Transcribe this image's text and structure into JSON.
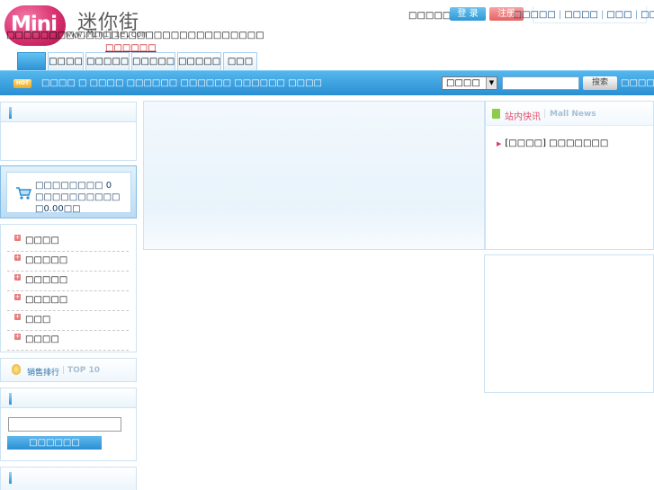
{
  "header": {
    "logo_text": "Mini",
    "logo_cn": "迷你街",
    "logo_url": "www.Minijie.com",
    "welcome": "□□□□□□",
    "login_label": "登 录",
    "register_label": "注册",
    "top_links": [
      "□□□□□",
      "□□□□",
      "□□□",
      "□□□"
    ]
  },
  "nav": {
    "tabs": [
      "",
      "□□□□",
      "□□□□□",
      "□□□□□",
      "□□□□□",
      "□□□"
    ],
    "hot_icon": "HOT",
    "hot_words": "□□□□ □ □□□□ □□□□□□ □□□□□□ □□□□□□ □□□□",
    "search_select": "□□□□",
    "search_placeholder": "",
    "search_button": "搜索",
    "advanced_search": "□□□□"
  },
  "sidebar": {
    "notice_text": "□□□□□□□□,□□□□□□□□□□□□□□□□□□□□□□",
    "notice_more": "□□□□□□",
    "cart_text": "□□□□□□□□ 0 □□□□□□□□□□ □0.00□□",
    "categories": [
      "□□□□",
      "□□□□□",
      "□□□□□",
      "□□□□□",
      "□□□",
      "□□□□"
    ],
    "rank_title": "销售排行",
    "rank_top": "TOP 10",
    "login_button": "□□□□□□"
  },
  "news": {
    "title": "站内快讯",
    "subtitle": "Mall News",
    "items": [
      "[□□□□] □□□□□□□"
    ]
  },
  "colors": {
    "accent": "#2a93d6",
    "logo_pink": "#d8306f",
    "news_title": "#e24d6a"
  }
}
